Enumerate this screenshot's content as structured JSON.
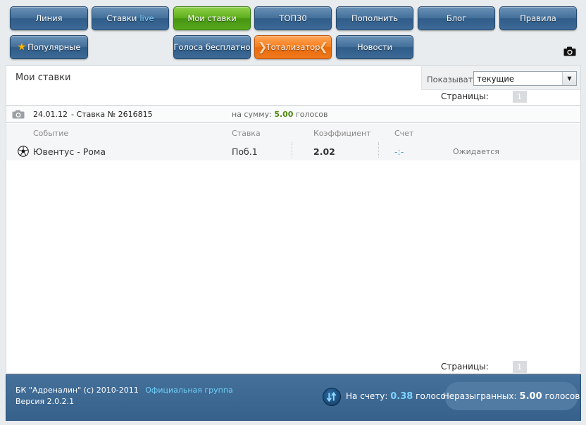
{
  "nav": {
    "row1": [
      "Линия",
      "Ставки",
      "Мои ставки",
      "ТОП30",
      "Пополнить",
      "Блог",
      "Правила"
    ],
    "live_label": "live",
    "row2": {
      "popular": "Популярные",
      "free_votes": "Голоса бесплатно",
      "totalizator": "Тотализатор",
      "news": "Новости"
    }
  },
  "panel": {
    "title": "Мои ставки",
    "filter_label": "Показывать",
    "filter_value": "текущие",
    "pages_label": "Страницы:",
    "page_number": "1"
  },
  "bet": {
    "date": "24.01.12",
    "number": "- Ставка № 2616815",
    "sum_label": "на сумму:",
    "sum_value": "5.00",
    "sum_unit": "голосов"
  },
  "table": {
    "headers": [
      "Событие",
      "Ставка",
      "Коэффициент",
      "Счет"
    ],
    "row": {
      "event": "Ювентус - Рома",
      "bet": "Поб.1",
      "coef": "2.02",
      "score": "-:-",
      "status": "Ожидается"
    }
  },
  "footer": {
    "copyright": "БК \"Адреналин\" (c) 2010-2011",
    "group_link": "Официальная группа",
    "version": "Версия 2.0.2.1",
    "balance_label": "На счету:",
    "balance_value": "0.38",
    "balance_unit": "голосов",
    "pending_label": "Неразыгранных:",
    "pending_value": "5.00",
    "pending_unit": "голосов"
  },
  "colors": {
    "nav_blue": "#44709b",
    "nav_green": "#5fae1c",
    "nav_orange": "#f77f1d",
    "footer_bg": "#3d6891",
    "accent_link": "#6fd0f8"
  },
  "icons": [
    "camera-icon",
    "star-icon",
    "soccer-ball-icon",
    "account-icon",
    "dropdown-arrow-icon"
  ]
}
